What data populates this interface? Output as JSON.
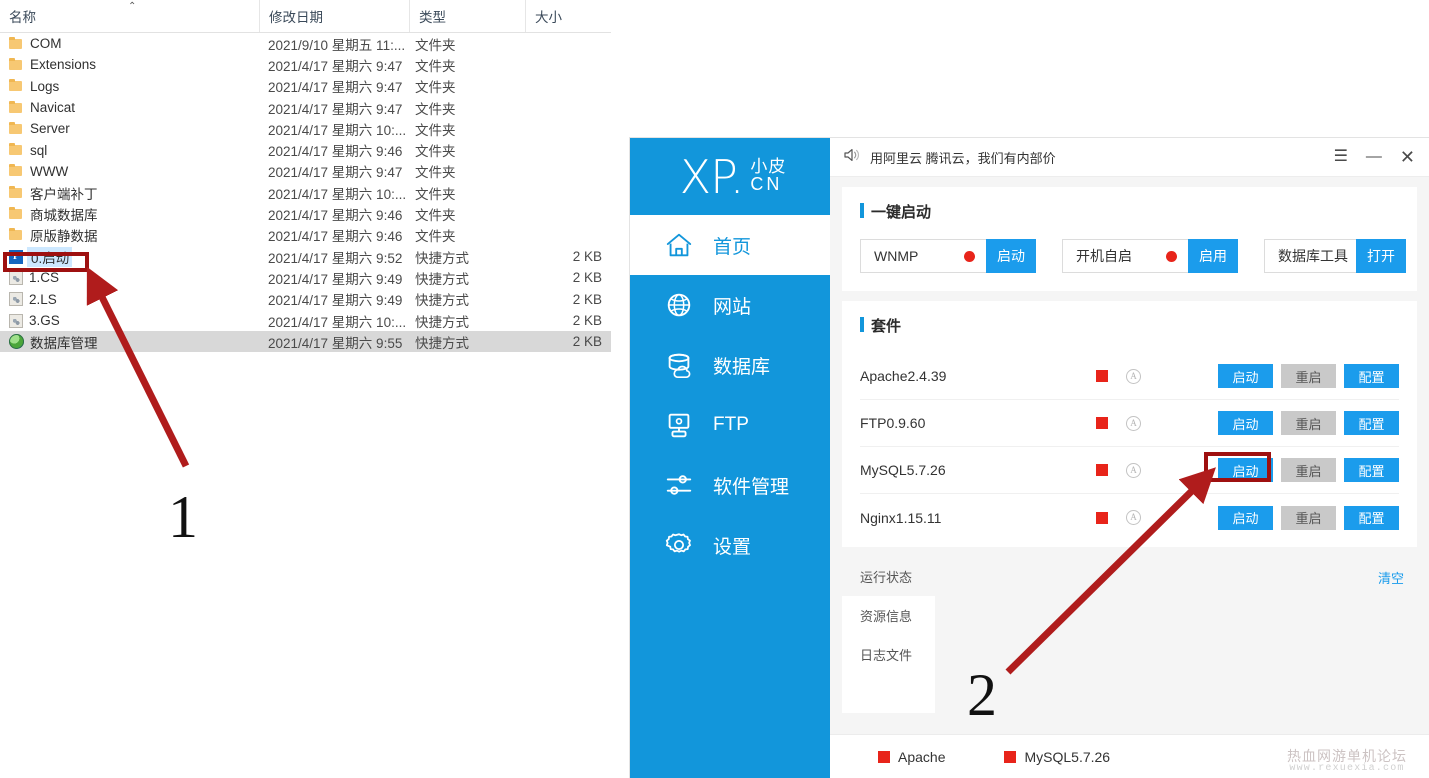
{
  "explorer": {
    "columns": [
      "名称",
      "修改日期",
      "类型",
      "大小"
    ],
    "sort_caret": "⌃",
    "rows": [
      {
        "icon": "folder-icon",
        "name": "COM",
        "date": "2021/9/10 星期五 11:...",
        "type": "文件夹",
        "size": ""
      },
      {
        "icon": "folder-icon",
        "name": "Extensions",
        "date": "2021/4/17 星期六 9:47",
        "type": "文件夹",
        "size": ""
      },
      {
        "icon": "folder-icon",
        "name": "Logs",
        "date": "2021/4/17 星期六 9:47",
        "type": "文件夹",
        "size": ""
      },
      {
        "icon": "folder-icon",
        "name": "Navicat",
        "date": "2021/4/17 星期六 9:47",
        "type": "文件夹",
        "size": ""
      },
      {
        "icon": "folder-icon",
        "name": "Server",
        "date": "2021/4/17 星期六 10:...",
        "type": "文件夹",
        "size": ""
      },
      {
        "icon": "folder-icon",
        "name": "sql",
        "date": "2021/4/17 星期六 9:46",
        "type": "文件夹",
        "size": ""
      },
      {
        "icon": "folder-icon",
        "name": "WWW",
        "date": "2021/4/17 星期六 9:47",
        "type": "文件夹",
        "size": ""
      },
      {
        "icon": "folder-icon",
        "name": "客户端补丁",
        "date": "2021/4/17 星期六 10:...",
        "type": "文件夹",
        "size": ""
      },
      {
        "icon": "folder-icon",
        "name": "商城数据库",
        "date": "2021/4/17 星期六 9:46",
        "type": "文件夹",
        "size": ""
      },
      {
        "icon": "folder-icon",
        "name": "原版静数据",
        "date": "2021/4/17 星期六 9:46",
        "type": "文件夹",
        "size": ""
      },
      {
        "icon": "phpstudy-shortcut-icon",
        "name": "0.启动",
        "date": "2021/4/17 星期六 9:52",
        "type": "快捷方式",
        "size": "2 KB",
        "selected_name": true
      },
      {
        "icon": "shortcut-icon",
        "name": "1.CS",
        "date": "2021/4/17 星期六 9:49",
        "type": "快捷方式",
        "size": "2 KB"
      },
      {
        "icon": "shortcut-icon",
        "name": "2.LS",
        "date": "2021/4/17 星期六 9:49",
        "type": "快捷方式",
        "size": "2 KB"
      },
      {
        "icon": "shortcut-icon",
        "name": "3.GS",
        "date": "2021/4/17 星期六 10:...",
        "type": "快捷方式",
        "size": "2 KB"
      },
      {
        "icon": "globe-icon",
        "name": "数据库管理",
        "date": "2021/4/17 星期六 9:55",
        "type": "快捷方式",
        "size": "2 KB",
        "row_selected": true
      }
    ]
  },
  "xp": {
    "logo": {
      "main": "XP.",
      "sub_top": "小皮",
      "sub_bottom": "CN"
    },
    "titlebar": {
      "speaker_icon": "speaker-icon",
      "marquee": "用阿里云 腾讯云，我们有内部价",
      "menu": "☰",
      "minimize": "—",
      "close": "✕"
    },
    "sidebar": {
      "items": [
        {
          "label": "首页",
          "icon": "home-icon",
          "active": true
        },
        {
          "label": "网站",
          "icon": "globe-icon",
          "active": false
        },
        {
          "label": "数据库",
          "icon": "database-icon",
          "active": false
        },
        {
          "label": "FTP",
          "icon": "ftp-icon",
          "active": false
        },
        {
          "label": "软件管理",
          "icon": "sliders-icon",
          "active": false
        },
        {
          "label": "设置",
          "icon": "gear-icon",
          "active": false
        }
      ]
    },
    "quick_start": {
      "title": "一键启动",
      "groups": [
        {
          "label": "WNMP",
          "status_color": "#e8241a",
          "button": "启动"
        },
        {
          "label": "开机自启",
          "status_color": "#e8241a",
          "button": "启用"
        },
        {
          "label": "数据库工具",
          "status_color": "",
          "button": "打开"
        }
      ]
    },
    "suite": {
      "title": "套件",
      "columns_buttons": [
        "启动",
        "重启",
        "配置"
      ],
      "rows": [
        {
          "name": "Apache2.4.39",
          "status_color": "#e8241a",
          "auto": "A",
          "start": "启动",
          "restart": "重启",
          "config": "配置"
        },
        {
          "name": "FTP0.9.60",
          "status_color": "#e8241a",
          "auto": "A",
          "start": "启动",
          "restart": "重启",
          "config": "配置"
        },
        {
          "name": "MySQL5.7.26",
          "status_color": "#e8241a",
          "auto": "A",
          "start": "启动",
          "restart": "重启",
          "config": "配置",
          "highlighted": true
        },
        {
          "name": "Nginx1.15.11",
          "status_color": "#e8241a",
          "auto": "A",
          "start": "启动",
          "restart": "重启",
          "config": "配置"
        }
      ]
    },
    "status_panel": {
      "tabs": [
        {
          "label": "运行状态",
          "active": true
        },
        {
          "label": "资源信息",
          "active": false
        },
        {
          "label": "日志文件",
          "active": false
        }
      ],
      "clear_link": "清空",
      "log_text": ""
    },
    "bottom_bar": {
      "legend": [
        {
          "label": "Apache",
          "color": "#e8241a"
        },
        {
          "label": "MySQL5.7.26",
          "color": "#e8241a"
        }
      ],
      "watermark_line1": "热血网游单机论坛",
      "watermark_line2": "www.rexuexia.com"
    }
  },
  "annotations": {
    "step_1": "1",
    "step_2": "2",
    "box_color": "#9e1010",
    "arrow_color": "#b01c1c"
  }
}
